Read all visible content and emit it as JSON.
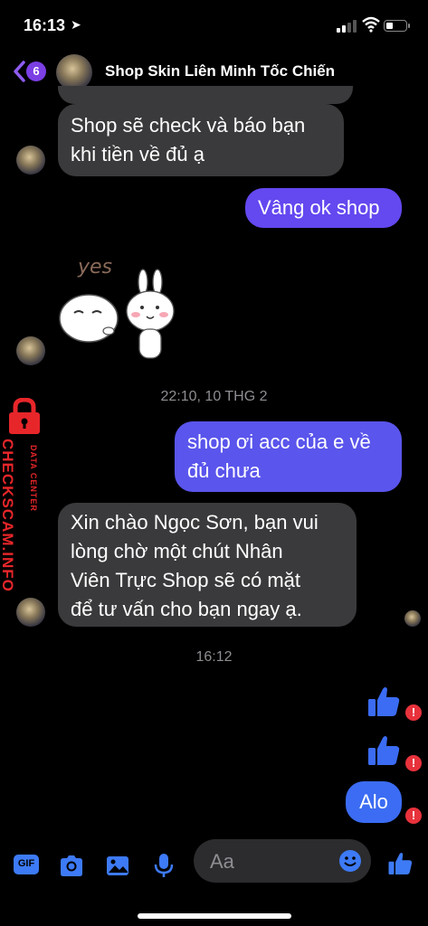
{
  "status_bar": {
    "time": "16:13"
  },
  "header": {
    "back_badge": "6",
    "title": "Shop Skin Liên Minh Tốc Chiến"
  },
  "messages": {
    "m1_line1": "Shop sẽ check và báo bạn",
    "m1_line2": "khi tiền về đủ ạ",
    "m2": "Vâng ok shop",
    "sticker_text": "yes",
    "timestamp1": "22:10, 10 THG 2",
    "m3_line1": "shop ơi acc của e về",
    "m3_line2": "đủ chưa",
    "m4_line1": "Xin chào Ngọc Sơn, bạn vui",
    "m4_line2": "lòng chờ một chút Nhân",
    "m4_line3": "Viên Trực Shop sẽ có mặt",
    "m4_line4": "để tư vấn cho bạn ngay ạ.",
    "timestamp2": "16:12",
    "error_mark": "!",
    "m5": "Alo"
  },
  "watermark": {
    "main": "CHECKSCAM.INFO",
    "sub": "DATA CENTER"
  },
  "composer": {
    "gif_label": "GIF",
    "placeholder": "Aa"
  },
  "colors": {
    "outgoing_bubble": "#6448f0",
    "outgoing_blue": "#3b6cf3",
    "incoming_bubble": "#3a3a3c",
    "accent": "#3d7af5",
    "error": "#e8323c"
  }
}
